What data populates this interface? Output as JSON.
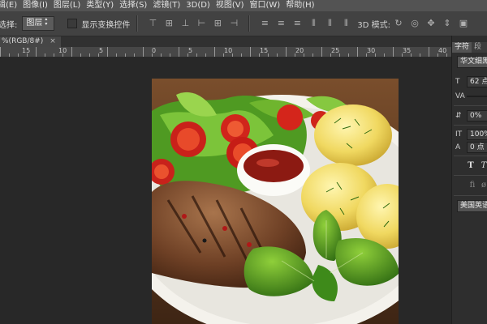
{
  "menu": {
    "items": [
      "辑(E)",
      "图像(I)",
      "图层(L)",
      "类型(Y)",
      "选择(S)",
      "滤镜(T)",
      "3D(D)",
      "视图(V)",
      "窗口(W)",
      "帮助(H)"
    ]
  },
  "options": {
    "select_label": "选择:",
    "select_value": "图层",
    "show_transform_label": "显示变换控件",
    "mode_3d_label": "3D 模式:"
  },
  "document": {
    "tab_label": "%(RGB/8#)",
    "close_glyph": "×"
  },
  "ruler": {
    "labels": [
      "15",
      "10",
      "5",
      "0",
      "5",
      "10",
      "15",
      "20",
      "25",
      "30",
      "35",
      "40"
    ]
  },
  "panel": {
    "tab_char": "字符",
    "tab_para": "段",
    "font_family": "华文细黑",
    "font_size": "62 点",
    "tracking_icon": "VA",
    "leading_value": "0%",
    "vscale": "100%",
    "baseline": "0 点",
    "t_bold": "T",
    "t_italic": "T",
    "language": "美国英语"
  },
  "colors": {
    "menubar": "#535353",
    "optbar": "#424242",
    "canvas": "#282828",
    "panel": "#2e2e2e"
  }
}
